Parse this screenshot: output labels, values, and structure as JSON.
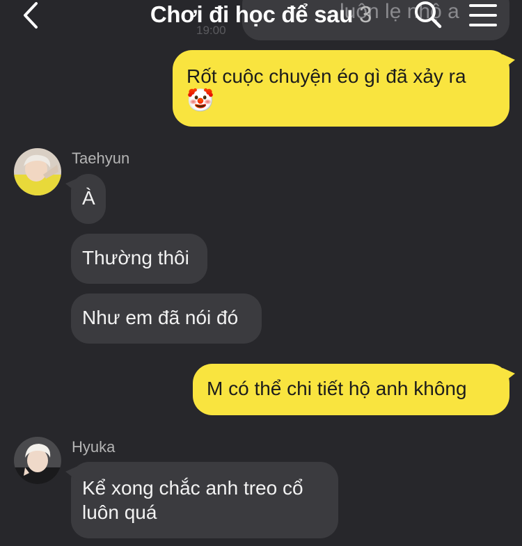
{
  "header": {
    "title": "Chơi đi học để sau",
    "member_count": "3",
    "back_icon": "chevron-left-icon",
    "search_icon": "search-icon",
    "menu_icon": "hamburger-menu-icon"
  },
  "previous_message": {
    "partial_text": "luôn lẹ nhộ a",
    "time": "19:00"
  },
  "messages": [
    {
      "type": "outgoing",
      "text": "Rốt cuộc chuyện éo gì đã xảy ra",
      "emoji": "🤡"
    },
    {
      "type": "incoming",
      "sender": "Taehyun",
      "text": "À"
    },
    {
      "type": "incoming",
      "sender": "Taehyun",
      "text": "Thường thôi"
    },
    {
      "type": "incoming",
      "sender": "Taehyun",
      "text": "Như em đã nói đó"
    },
    {
      "type": "outgoing",
      "text": "M có thể chi tiết hộ anh không"
    },
    {
      "type": "incoming",
      "sender": "Hyuka",
      "text": "Kể xong chắc anh treo cổ luôn quá"
    }
  ],
  "colors": {
    "background": "#27272b",
    "outgoing_bubble": "#f9e43f",
    "incoming_bubble": "#3b3b3f"
  }
}
